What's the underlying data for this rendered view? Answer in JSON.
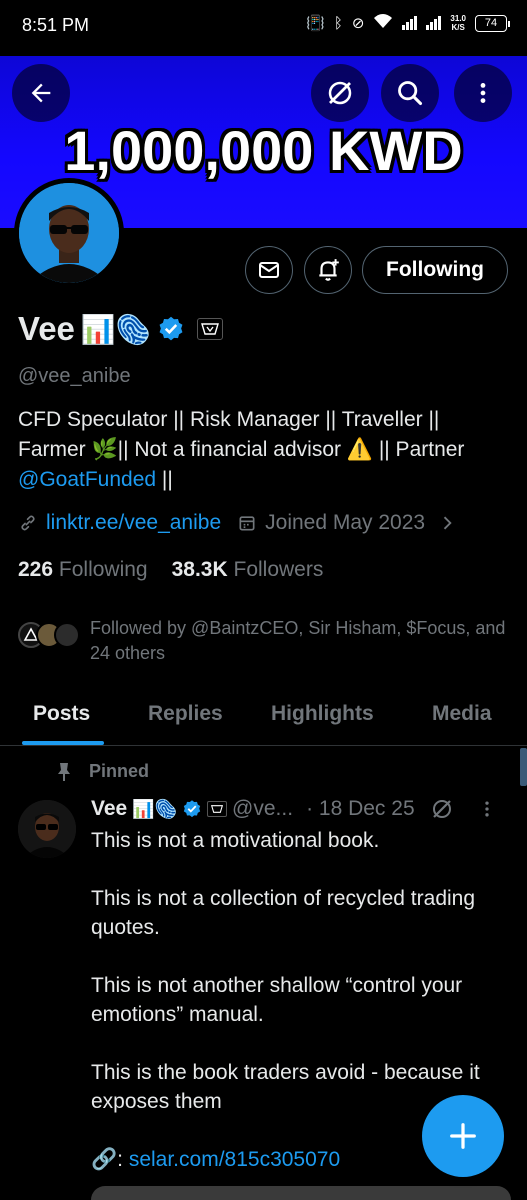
{
  "status_bar": {
    "time": "8:51 PM",
    "network_speed_value": "31.0",
    "network_speed_unit": "K/S",
    "battery": "74"
  },
  "banner": {
    "text": "1,000,000 KWD"
  },
  "actions": {
    "following_label": "Following"
  },
  "profile": {
    "name": "Vee",
    "name_emojis": "📊🫆",
    "handle": "@vee_anibe",
    "bio_line1": "CFD Speculator || Risk Manager || Traveller ||",
    "bio_line2_a": "Farmer 🌿|| Not a financial advisor ⚠️ || Partner",
    "bio_mention": "@GoatFunded",
    "bio_line3_end": " ||",
    "link": "linktr.ee/vee_anibe",
    "joined": "Joined May 2023",
    "following_count": "226",
    "following_label": "Following",
    "followers_count": "38.3K",
    "followers_label": "Followers",
    "followed_by": "Followed by @BaintzCEO, Sir Hisham, $Focus, and 24 others"
  },
  "tabs": [
    {
      "label": "Posts"
    },
    {
      "label": "Replies"
    },
    {
      "label": "Highlights"
    },
    {
      "label": "Media"
    }
  ],
  "post": {
    "pinned_label": "Pinned",
    "name": "Vee",
    "name_emojis": "📊🫆",
    "handle": "@ve...",
    "date": "· 18 Dec 25",
    "p1": "This is not a motivational book.",
    "p2": "This is not a collection of recycled trading quotes.",
    "p3": "This is not another shallow “control your emotions” manual.",
    "p4": "This is the book traders avoid - because it exposes them",
    "link_prefix": "🔗:",
    "link": "selar.com/815c305070"
  },
  "colors": {
    "accent": "#1d9bf0",
    "banner": "#1407ff",
    "muted": "#71767b"
  },
  "icons": [
    "back-arrow-icon",
    "grok-icon",
    "search-icon",
    "more-vertical-icon",
    "mail-icon",
    "notification-bell-icon",
    "verified-badge-icon",
    "link-icon",
    "calendar-icon",
    "chevron-right-icon",
    "pin-icon",
    "plus-icon"
  ]
}
